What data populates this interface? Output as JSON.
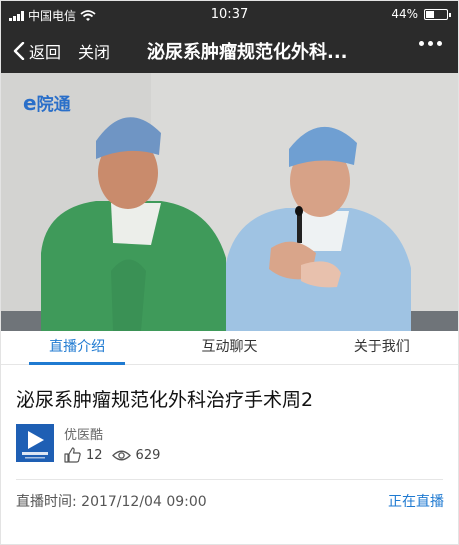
{
  "status_bar": {
    "carrier": "中国电信",
    "time": "10:37",
    "battery_percent": "44%",
    "battery_level": 0.44
  },
  "nav": {
    "back_label": "返回",
    "close_label": "关闭",
    "title": "泌尿系肿瘤规范化外科..."
  },
  "video": {
    "watermark_e": "e",
    "watermark_text": "院通"
  },
  "tabs": [
    {
      "label": "直播介绍",
      "active": true
    },
    {
      "label": "互动聊天",
      "active": false
    },
    {
      "label": "关于我们",
      "active": false
    }
  ],
  "program": {
    "title": "泌尿系肿瘤规范化外科治疗手术周2",
    "channel_name": "优医酷",
    "likes": "12",
    "views": "629",
    "time_label": "直播时间:",
    "time_value": "2017/12/04 09:00",
    "status": "正在直播"
  },
  "colors": {
    "accent": "#1f7ad1",
    "bar": "#2b2b2b",
    "logo_bg": "#1e5fb4"
  }
}
